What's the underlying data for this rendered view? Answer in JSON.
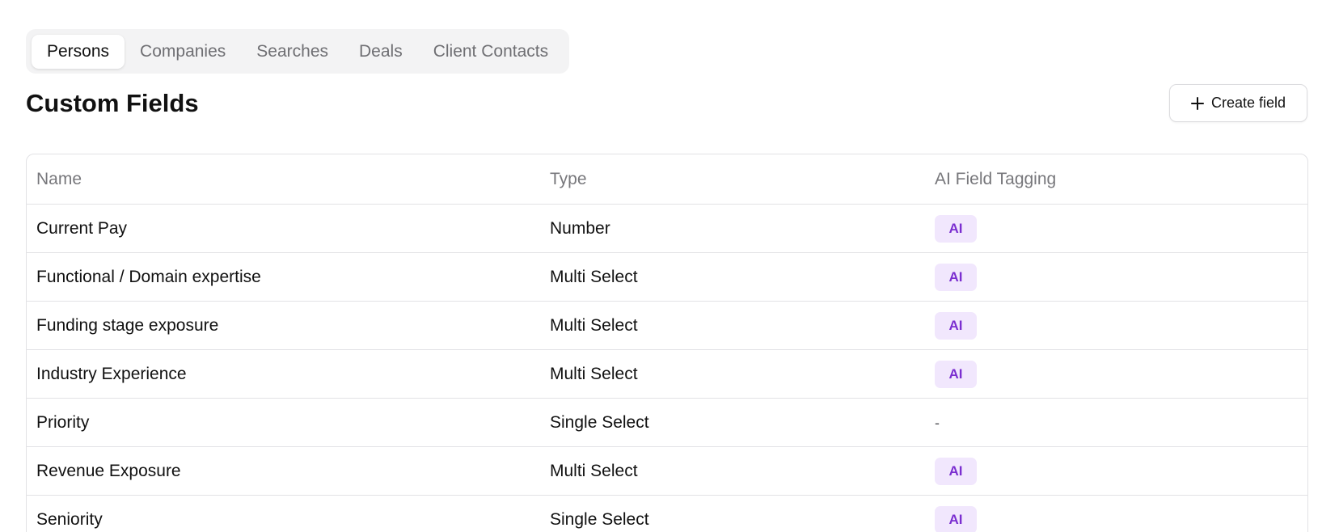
{
  "tabs": [
    {
      "label": "Persons",
      "active": true
    },
    {
      "label": "Companies",
      "active": false
    },
    {
      "label": "Searches",
      "active": false
    },
    {
      "label": "Deals",
      "active": false
    },
    {
      "label": "Client Contacts",
      "active": false
    }
  ],
  "page_title": "Custom Fields",
  "create_button": {
    "label": "Create field",
    "icon": "plus-icon"
  },
  "table": {
    "columns": [
      "Name",
      "Type",
      "AI Field Tagging"
    ],
    "rows": [
      {
        "name": "Current Pay",
        "type": "Number",
        "ai": "AI"
      },
      {
        "name": "Functional / Domain expertise",
        "type": "Multi Select",
        "ai": "AI"
      },
      {
        "name": "Funding stage exposure",
        "type": "Multi Select",
        "ai": "AI"
      },
      {
        "name": "Industry Experience",
        "type": "Multi Select",
        "ai": "AI"
      },
      {
        "name": "Priority",
        "type": "Single Select",
        "ai": "-"
      },
      {
        "name": "Revenue Exposure",
        "type": "Multi Select",
        "ai": "AI"
      },
      {
        "name": "Seniority",
        "type": "Single Select",
        "ai": "AI"
      }
    ]
  },
  "colors": {
    "ai_badge_bg": "#f1e7fd",
    "ai_badge_text": "#7b2fd0",
    "tab_bar_bg": "#f3f3f4",
    "border": "#e2e2e5"
  }
}
